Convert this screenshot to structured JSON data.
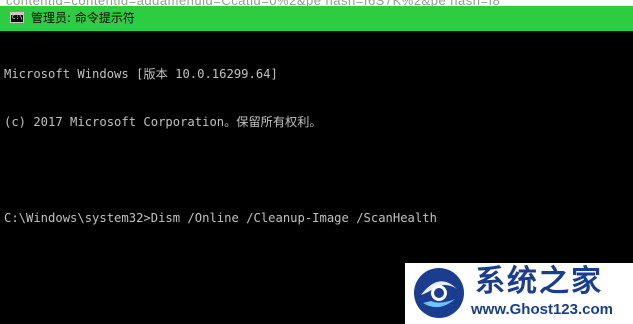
{
  "background_page": {
    "partial_text": "contentid=contentid=addamenuid=Ccatid=0%2&pe hash=f6S7K%2&pe hash=f8"
  },
  "window": {
    "title": "管理员: 命令提示符",
    "icon": "cmd-console-icon",
    "icon_glyph": "C:\\",
    "title_bar_color": "#2ecc40"
  },
  "console": {
    "lines": [
      "Microsoft Windows [版本 10.0.16299.64]",
      "(c) 2017 Microsoft Corporation。保留所有权利。",
      "",
      "C:\\Windows\\system32>Dism /Online /Cleanup-Image /ScanHealth"
    ],
    "text_color": "#c0c0c0",
    "background_color": "#000000"
  },
  "watermark": {
    "title": "系统之家",
    "url": "www.Ghost123.com",
    "color": "#1a3d8f"
  }
}
